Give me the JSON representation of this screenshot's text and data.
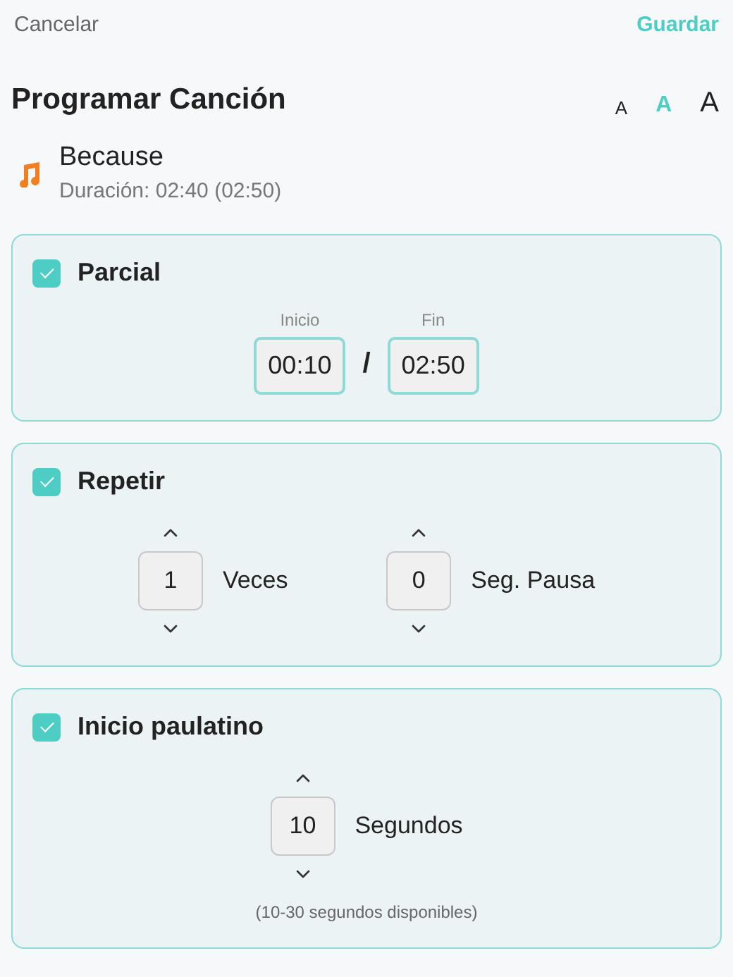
{
  "top_bar": {
    "cancel": "Cancelar",
    "save": "Guardar"
  },
  "title": "Programar Canción",
  "font_sizes": [
    {
      "label": "A",
      "kind": "small",
      "selected": false
    },
    {
      "label": "A",
      "kind": "medium",
      "selected": true
    },
    {
      "label": "A",
      "kind": "large",
      "selected": false
    }
  ],
  "song": {
    "name": "Because",
    "duration": "Duración: 02:40 (02:50)"
  },
  "sections": [
    {
      "kind": "range",
      "title": "Parcial",
      "checked": true,
      "start": {
        "label": "Inicio",
        "value": "00:10"
      },
      "separator": "/",
      "end": {
        "label": "Fin",
        "value": "02:50"
      }
    },
    {
      "kind": "steppers",
      "title": "Repetir",
      "checked": true,
      "steppers": [
        {
          "value": "1",
          "label": "Veces"
        },
        {
          "value": "0",
          "label": "Seg. Pausa"
        }
      ]
    },
    {
      "kind": "steppers",
      "title": "Inicio paulatino",
      "checked": true,
      "steppers": [
        {
          "value": "10",
          "label": "Segundos"
        }
      ],
      "note": "(10-30 segundos disponibles)"
    }
  ]
}
